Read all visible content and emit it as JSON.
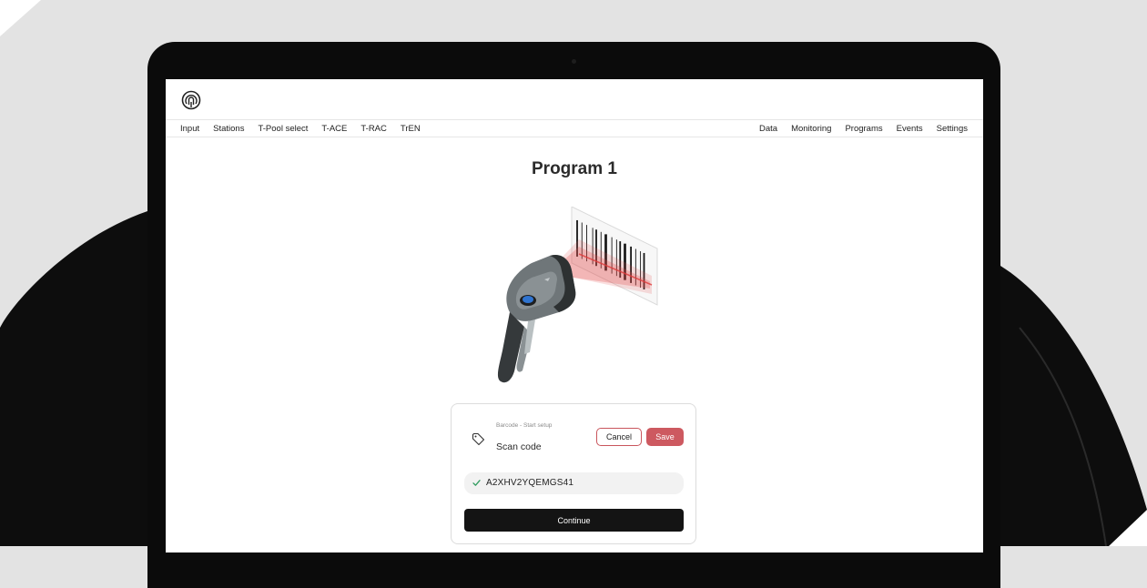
{
  "nav": {
    "left": [
      "Input",
      "Stations",
      "T-Pool select",
      "T-ACE",
      "T-RAC",
      "TrEN"
    ],
    "right": [
      "Data",
      "Monitoring",
      "Programs",
      "Events",
      "Settings"
    ]
  },
  "page": {
    "title": "Program 1"
  },
  "card": {
    "field_label": "Barcode - Start setup",
    "field_value": "Scan code",
    "cancel_label": "Cancel",
    "save_label": "Save",
    "scanned_code": "A2XHV2YQEMGS41",
    "continue_label": "Continue"
  },
  "colors": {
    "accent": "#cd5960",
    "dark_button": "#141414",
    "success": "#2e9b5e",
    "scanner_led": "#2f74d0"
  },
  "icons": [
    "logo-icon",
    "tag-icon",
    "check-icon",
    "barcode-scanner-illustration"
  ]
}
